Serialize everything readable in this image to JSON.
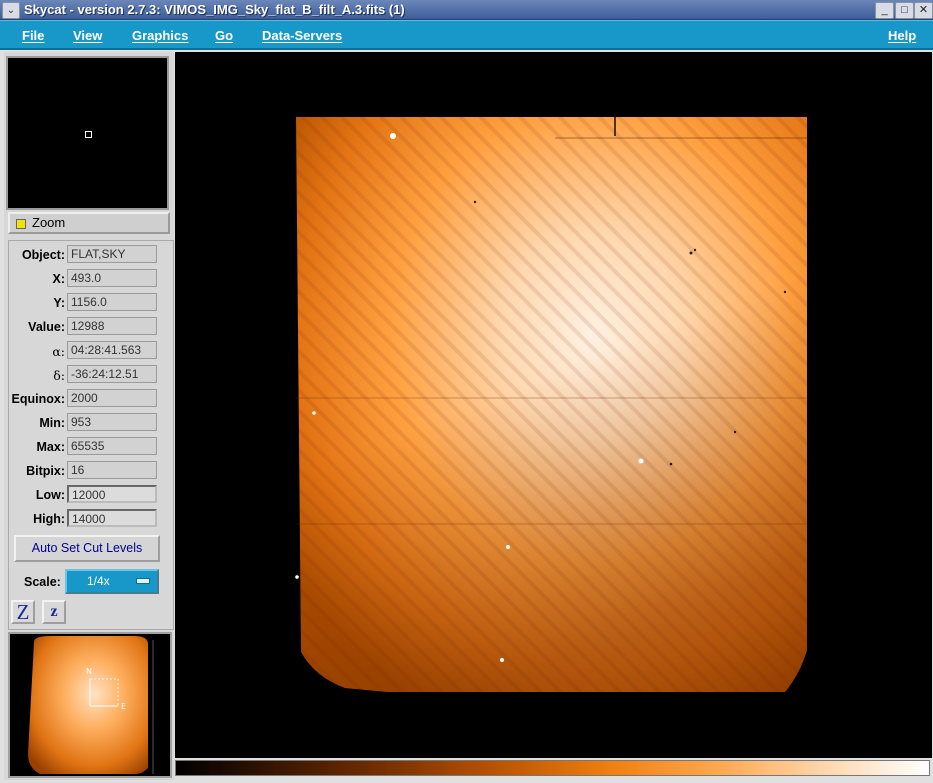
{
  "window": {
    "title": "Skycat - version 2.7.3: VIMOS_IMG_Sky_flat_B_filt_A.3.fits (1)",
    "menu_glyph": "⌄",
    "minimize_glyph": "_",
    "maximize_glyph": "□",
    "close_glyph": "✕"
  },
  "menubar": {
    "file": "File",
    "view": "View",
    "graphics": "Graphics",
    "go": "Go",
    "data_servers": "Data-Servers",
    "help": "Help"
  },
  "zoom": {
    "label": "Zoom",
    "checked": true
  },
  "info": {
    "object_label": "Object:",
    "object_value": "FLAT,SKY",
    "x_label": "X:",
    "x_value": "493.0",
    "y_label": "Y:",
    "y_value": "1156.0",
    "value_label": "Value:",
    "value_value": "12988",
    "alpha_label": "α:",
    "alpha_value": "04:28:41.563",
    "delta_label": "δ:",
    "delta_value": "-36:24:12.51",
    "equinox_label": "Equinox:",
    "equinox_value": "2000",
    "min_label": "Min:",
    "min_value": "953",
    "max_label": "Max:",
    "max_value": "65535",
    "bitpix_label": "Bitpix:",
    "bitpix_value": "16",
    "low_label": "Low:",
    "low_value": "12000",
    "high_label": "High:",
    "high_value": "14000"
  },
  "controls": {
    "auto_cut_label": "Auto Set Cut Levels",
    "scale_label": "Scale:",
    "scale_value": "1/4x",
    "zoom_in_glyph": "Z",
    "zoom_out_glyph": "z"
  },
  "colors": {
    "menubar": "#1898c8",
    "titlebar": "#3d5e9c",
    "image_dark": "#c45e00",
    "image_mid": "#f08a1a",
    "image_light": "#ffe0c0",
    "auto_button_text": "#000090"
  },
  "compass": {
    "north": "N",
    "east": "E"
  }
}
